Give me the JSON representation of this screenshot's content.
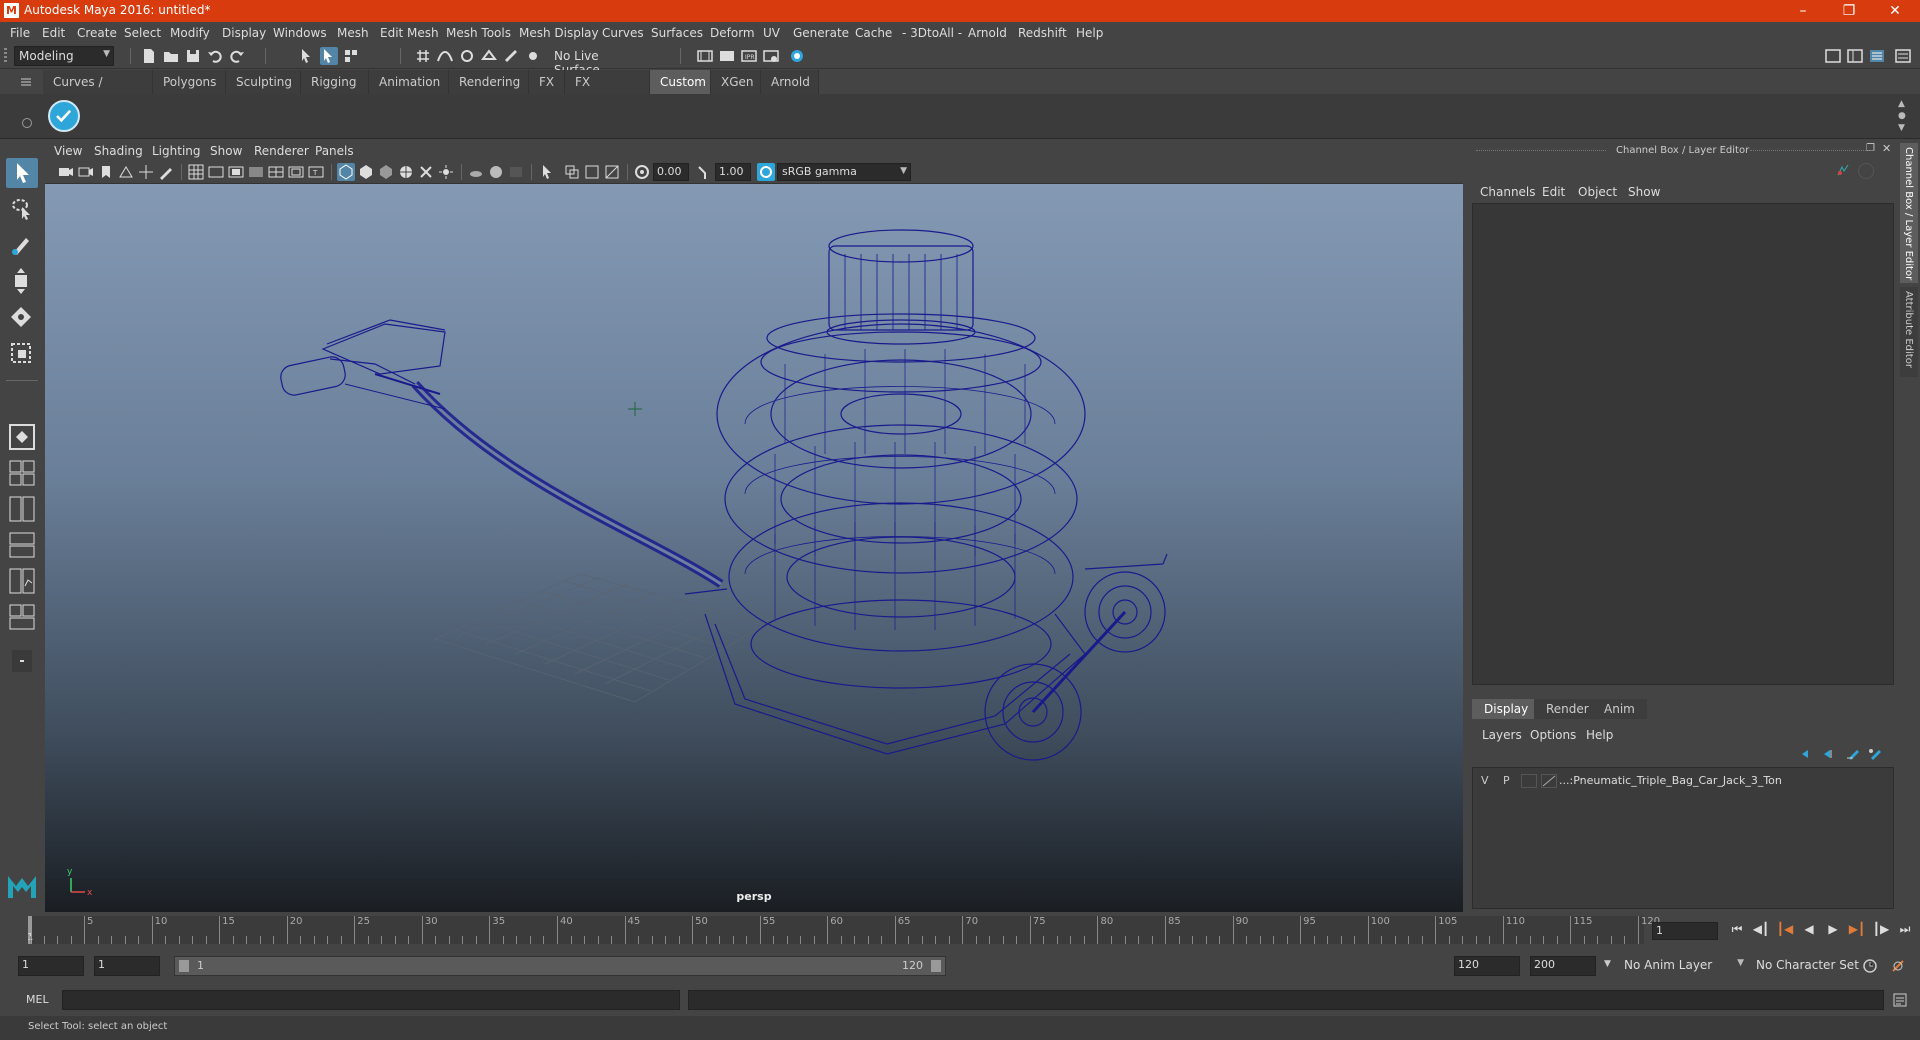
{
  "window": {
    "title": "Autodesk Maya 2016: untitled*",
    "app_icon": "maya-icon",
    "controls": [
      "minimize",
      "restore",
      "close"
    ]
  },
  "menubar": {
    "items": [
      "File",
      "Edit",
      "Create",
      "Select",
      "Modify",
      "Display",
      "Windows",
      "Mesh",
      "Edit Mesh",
      "Mesh Tools",
      "Mesh Display",
      "Curves",
      "Surfaces",
      "Deform",
      "UV",
      "Generate",
      "Cache",
      "- 3DtoAll -",
      "Arnold",
      "Redshift",
      "Help"
    ]
  },
  "statusline": {
    "mode": "Modeling",
    "live_surface": "No Live Surface"
  },
  "shelf": {
    "tabs": [
      "Curves / Surfaces",
      "Polygons",
      "Sculpting",
      "Rigging",
      "Animation",
      "Rendering",
      "FX",
      "FX Caching",
      "Custom",
      "XGen",
      "Arnold"
    ],
    "active_tab": "Custom"
  },
  "viewport": {
    "menu": [
      "View",
      "Shading",
      "Lighting",
      "Show",
      "Renderer",
      "Panels"
    ],
    "exposure": "0.00",
    "gamma": "1.00",
    "color_space": "sRGB gamma",
    "camera_label": "persp",
    "wire_color": "#1a1a8c"
  },
  "channelbox": {
    "title": "Channel Box / Layer Editor",
    "menu": [
      "Channels",
      "Edit",
      "Object",
      "Show"
    ],
    "layer_tabs": [
      "Display",
      "Render",
      "Anim"
    ],
    "active_layer_tab": "Display",
    "layer_menu": [
      "Layers",
      "Options",
      "Help"
    ],
    "layers": [
      {
        "v": "V",
        "p": "P",
        "name": "...:Pneumatic_Triple_Bag_Car_Jack_3_Ton"
      }
    ],
    "side_tabs": [
      "Channel Box / Layer Editor",
      "Attribute Editor"
    ]
  },
  "timeslider": {
    "ticks": [
      "5",
      "10",
      "15",
      "20",
      "25",
      "30",
      "35",
      "40",
      "45",
      "50",
      "55",
      "60",
      "65",
      "70",
      "75",
      "80",
      "85",
      "90",
      "95",
      "100",
      "105",
      "110",
      "115",
      "120"
    ],
    "start_label": "1",
    "current_frame": "1"
  },
  "range": {
    "start": "1",
    "playback_start": "1",
    "range_start_label": "1",
    "range_end_label": "120",
    "playback_end": "120",
    "end": "200",
    "anim_layer": "No Anim Layer",
    "character_set": "No Character Set"
  },
  "cmdline": {
    "label": "MEL"
  },
  "helpline": {
    "text": "Select Tool: select an object"
  }
}
